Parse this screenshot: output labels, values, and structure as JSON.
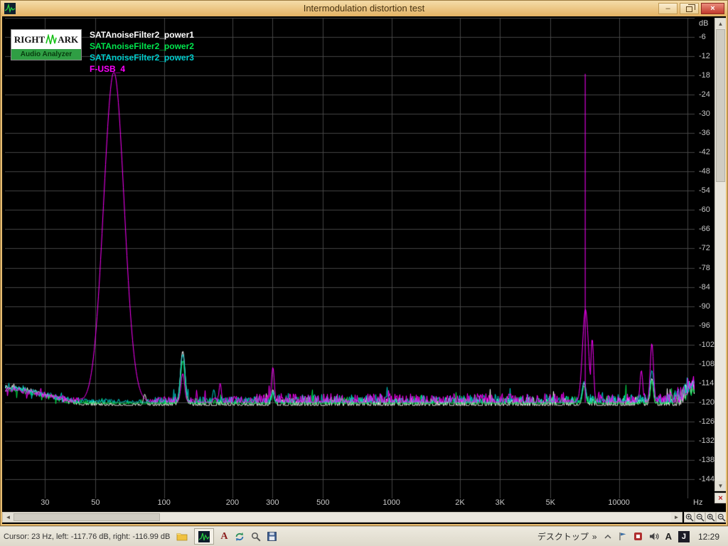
{
  "window": {
    "title": "Intermodulation distortion test",
    "controls": {
      "minimize": "–",
      "close": "×"
    }
  },
  "logo": {
    "line1_left": "RIGHT",
    "line1_right": "ARK",
    "line2": "Audio Analyzer"
  },
  "axes": {
    "y_unit": "dB",
    "y_ticks": [
      -6,
      -12,
      -18,
      -24,
      -30,
      -36,
      -42,
      -48,
      -54,
      -60,
      -66,
      -72,
      -78,
      -84,
      -90,
      -96,
      -102,
      -108,
      -114,
      -120,
      -126,
      -132,
      -138,
      -144
    ],
    "x_unit": "Hz",
    "x_ticks": [
      {
        "hz": 30,
        "label": "30"
      },
      {
        "hz": 50,
        "label": "50"
      },
      {
        "hz": 100,
        "label": "100"
      },
      {
        "hz": 200,
        "label": "200"
      },
      {
        "hz": 300,
        "label": "300"
      },
      {
        "hz": 500,
        "label": "500"
      },
      {
        "hz": 1000,
        "label": "1000"
      },
      {
        "hz": 2000,
        "label": "2K"
      },
      {
        "hz": 3000,
        "label": "3K"
      },
      {
        "hz": 5000,
        "label": "5K"
      },
      {
        "hz": 10000,
        "label": "10000"
      }
    ]
  },
  "chart_data": {
    "type": "line",
    "title": "Intermodulation distortion test",
    "x_scale": "log",
    "x_range_hz": [
      20,
      21500
    ],
    "y_range_db": [
      -150,
      0
    ],
    "grid_db_step": 6,
    "x_gridlines_hz": [
      30,
      50,
      100,
      200,
      300,
      500,
      1000,
      2000,
      3000,
      5000,
      10000,
      20000
    ],
    "grid_color": "#454545",
    "series": [
      {
        "name": "SATAnoiseFilter2_power1",
        "color": "#ffffff",
        "noise_floor_db": -121,
        "jitter_db": 5,
        "low_end_db": -115,
        "high_end_db": -115,
        "peaks": [
          {
            "hz": 82,
            "db": -117.5,
            "w": 0.006
          },
          {
            "hz": 120.5,
            "db": -104,
            "w": 0.01
          },
          {
            "hz": 300,
            "db": -116,
            "w": 0.006
          },
          {
            "hz": 7000,
            "db": -114,
            "w": 0.008
          },
          {
            "hz": 13900,
            "db": -112.5,
            "w": 0.007
          }
        ]
      },
      {
        "name": "SATAnoiseFilter2_power2",
        "color": "#00e64d",
        "noise_floor_db": -120.5,
        "jitter_db": 5,
        "low_end_db": -116,
        "high_end_db": -115.5,
        "peaks": [
          {
            "hz": 120.5,
            "db": -107,
            "w": 0.009
          },
          {
            "hz": 300,
            "db": -117,
            "w": 0.005
          },
          {
            "hz": 7000,
            "db": -115,
            "w": 0.007
          },
          {
            "hz": 13900,
            "db": -113,
            "w": 0.006
          }
        ]
      },
      {
        "name": "SATAnoiseFilter2_power3",
        "color": "#00cfcf",
        "noise_floor_db": -120,
        "jitter_db": 5,
        "low_end_db": -115.5,
        "high_end_db": -114.5,
        "peaks": [
          {
            "hz": 120.5,
            "db": -105,
            "w": 0.01
          },
          {
            "hz": 165,
            "db": -116,
            "w": 0.005
          },
          {
            "hz": 300,
            "db": -116.5,
            "w": 0.005
          },
          {
            "hz": 7000,
            "db": -113.5,
            "w": 0.008
          },
          {
            "hz": 13900,
            "db": -110,
            "w": 0.008
          }
        ]
      },
      {
        "name": "F-USB_4",
        "color": "#ff00ff",
        "noise_floor_db": -120,
        "jitter_db": 5.5,
        "low_end_db": -116,
        "high_end_db": -114,
        "peaks": [
          {
            "hz": 60,
            "db": -17,
            "w": 0.045
          },
          {
            "hz": 120.5,
            "db": -111,
            "w": 0.008
          },
          {
            "hz": 176,
            "db": -114,
            "w": 0.005
          },
          {
            "hz": 300,
            "db": -109,
            "w": 0.006
          },
          {
            "hz": 7100,
            "db": -91,
            "w": 0.013
          },
          {
            "hz": 7080,
            "db": -17.5,
            "w": 0.003
          },
          {
            "hz": 7600,
            "db": -100,
            "w": 0.006
          },
          {
            "hz": 12500,
            "db": -110,
            "w": 0.006
          },
          {
            "hz": 13900,
            "db": -101.5,
            "w": 0.007
          }
        ]
      }
    ]
  },
  "statusbar": {
    "text": "Cursor: 23 Hz, left: -117.76 dB, right: -116.99 dB"
  },
  "taskbar": {
    "desktop_label": "デスクトップ",
    "more_chevron": "»",
    "font_a": "A",
    "ime_a": "A",
    "j_label": "J",
    "clock": "12:29"
  }
}
